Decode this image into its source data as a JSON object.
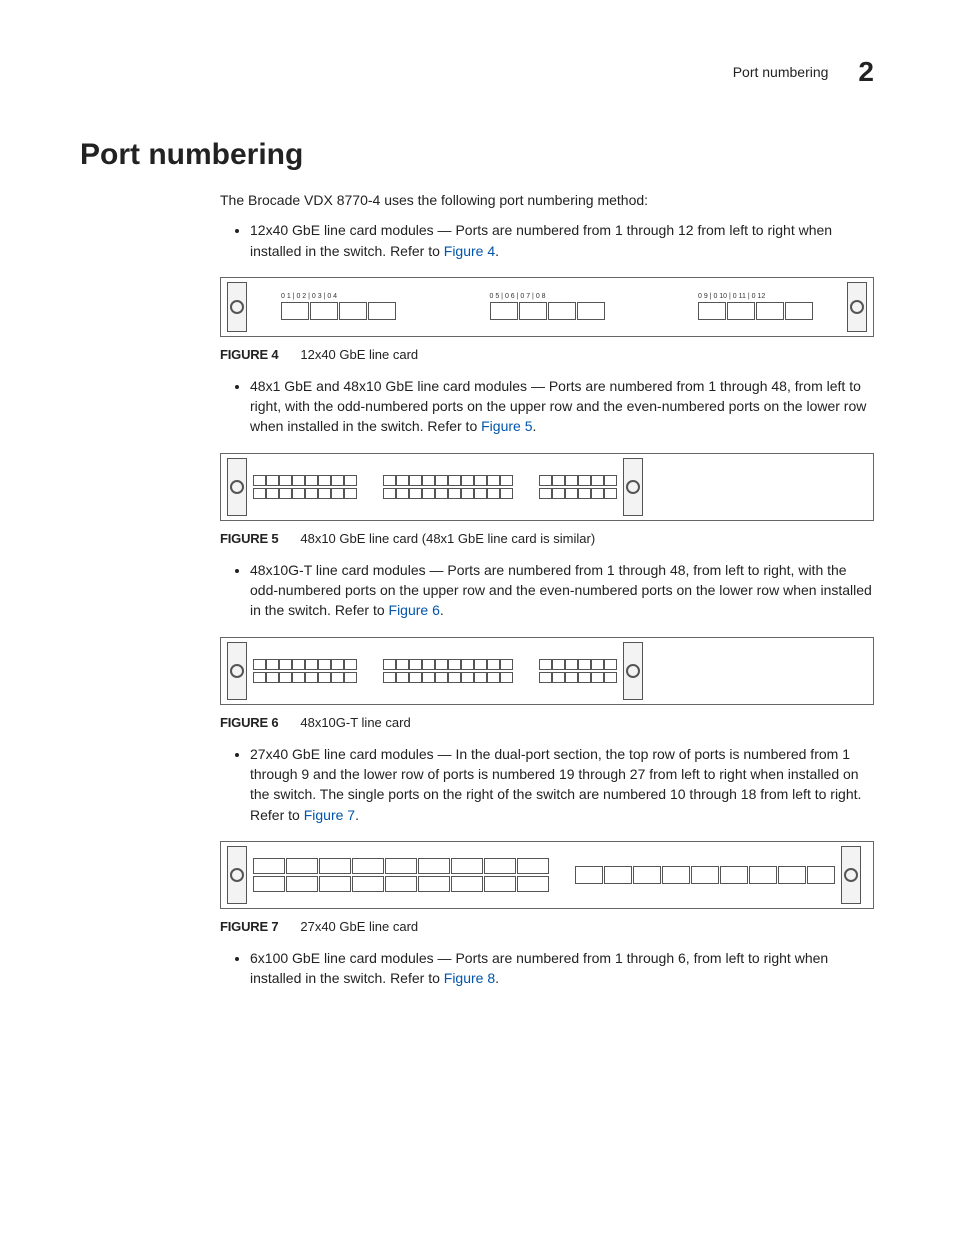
{
  "header": {
    "running_title": "Port numbering",
    "chapter_number": "2"
  },
  "title": "Port numbering",
  "intro": "The Brocade VDX 8770-4 uses the following port numbering method:",
  "bullets": [
    {
      "text_before": "12x40 GbE line card modules — Ports are numbered from 1 through 12 from left to right when installed in the switch. Refer to ",
      "xref": "Figure 4",
      "text_after": "."
    },
    {
      "text_before": "48x1 GbE and 48x10 GbE line card modules — Ports are numbered from 1 through 48, from left to right, with the odd-numbered ports on the upper row and the even-numbered ports on the lower row when installed in the switch. Refer to ",
      "xref": "Figure 5",
      "text_after": "."
    },
    {
      "text_before": "48x10G-T line card modules — Ports are numbered from 1 through 48, from left to right, with the odd-numbered ports on the upper row and the even-numbered ports on the lower row when installed in the switch. Refer to ",
      "xref": "Figure 6",
      "text_after": "."
    },
    {
      "text_before": "27x40 GbE line card modules — In the dual-port section, the top row of ports is numbered from 1 through 9 and the lower row of ports is numbered 19 through 27 from left to right when installed on the switch. The single ports on the right of the switch are numbered 10 through 18 from left to right. Refer to ",
      "xref": "Figure 7",
      "text_after": "."
    },
    {
      "text_before": "6x100 GbE line card modules — Ports are numbered from 1 through 6, from left to right when installed in the switch. Refer to ",
      "xref": "Figure 8",
      "text_after": "."
    }
  ],
  "figures": {
    "f4": {
      "label": "FIGURE 4",
      "caption": "12x40 GbE line card"
    },
    "f5": {
      "label": "FIGURE 5",
      "caption": "48x10 GbE line card (48x1 GbE line card is similar)"
    },
    "f6": {
      "label": "FIGURE 6",
      "caption": "48x10G-T line card"
    },
    "f7": {
      "label": "FIGURE 7",
      "caption": "27x40 GbE line card"
    }
  },
  "fig4_ports": {
    "g1": "0 1  |  0 2  |  0 3  |  0 4",
    "g2": "0 5  |  0 6  |  0 7  |  0 8",
    "g3": "0 9  |  0 10 |  0 11 |  0 12"
  }
}
